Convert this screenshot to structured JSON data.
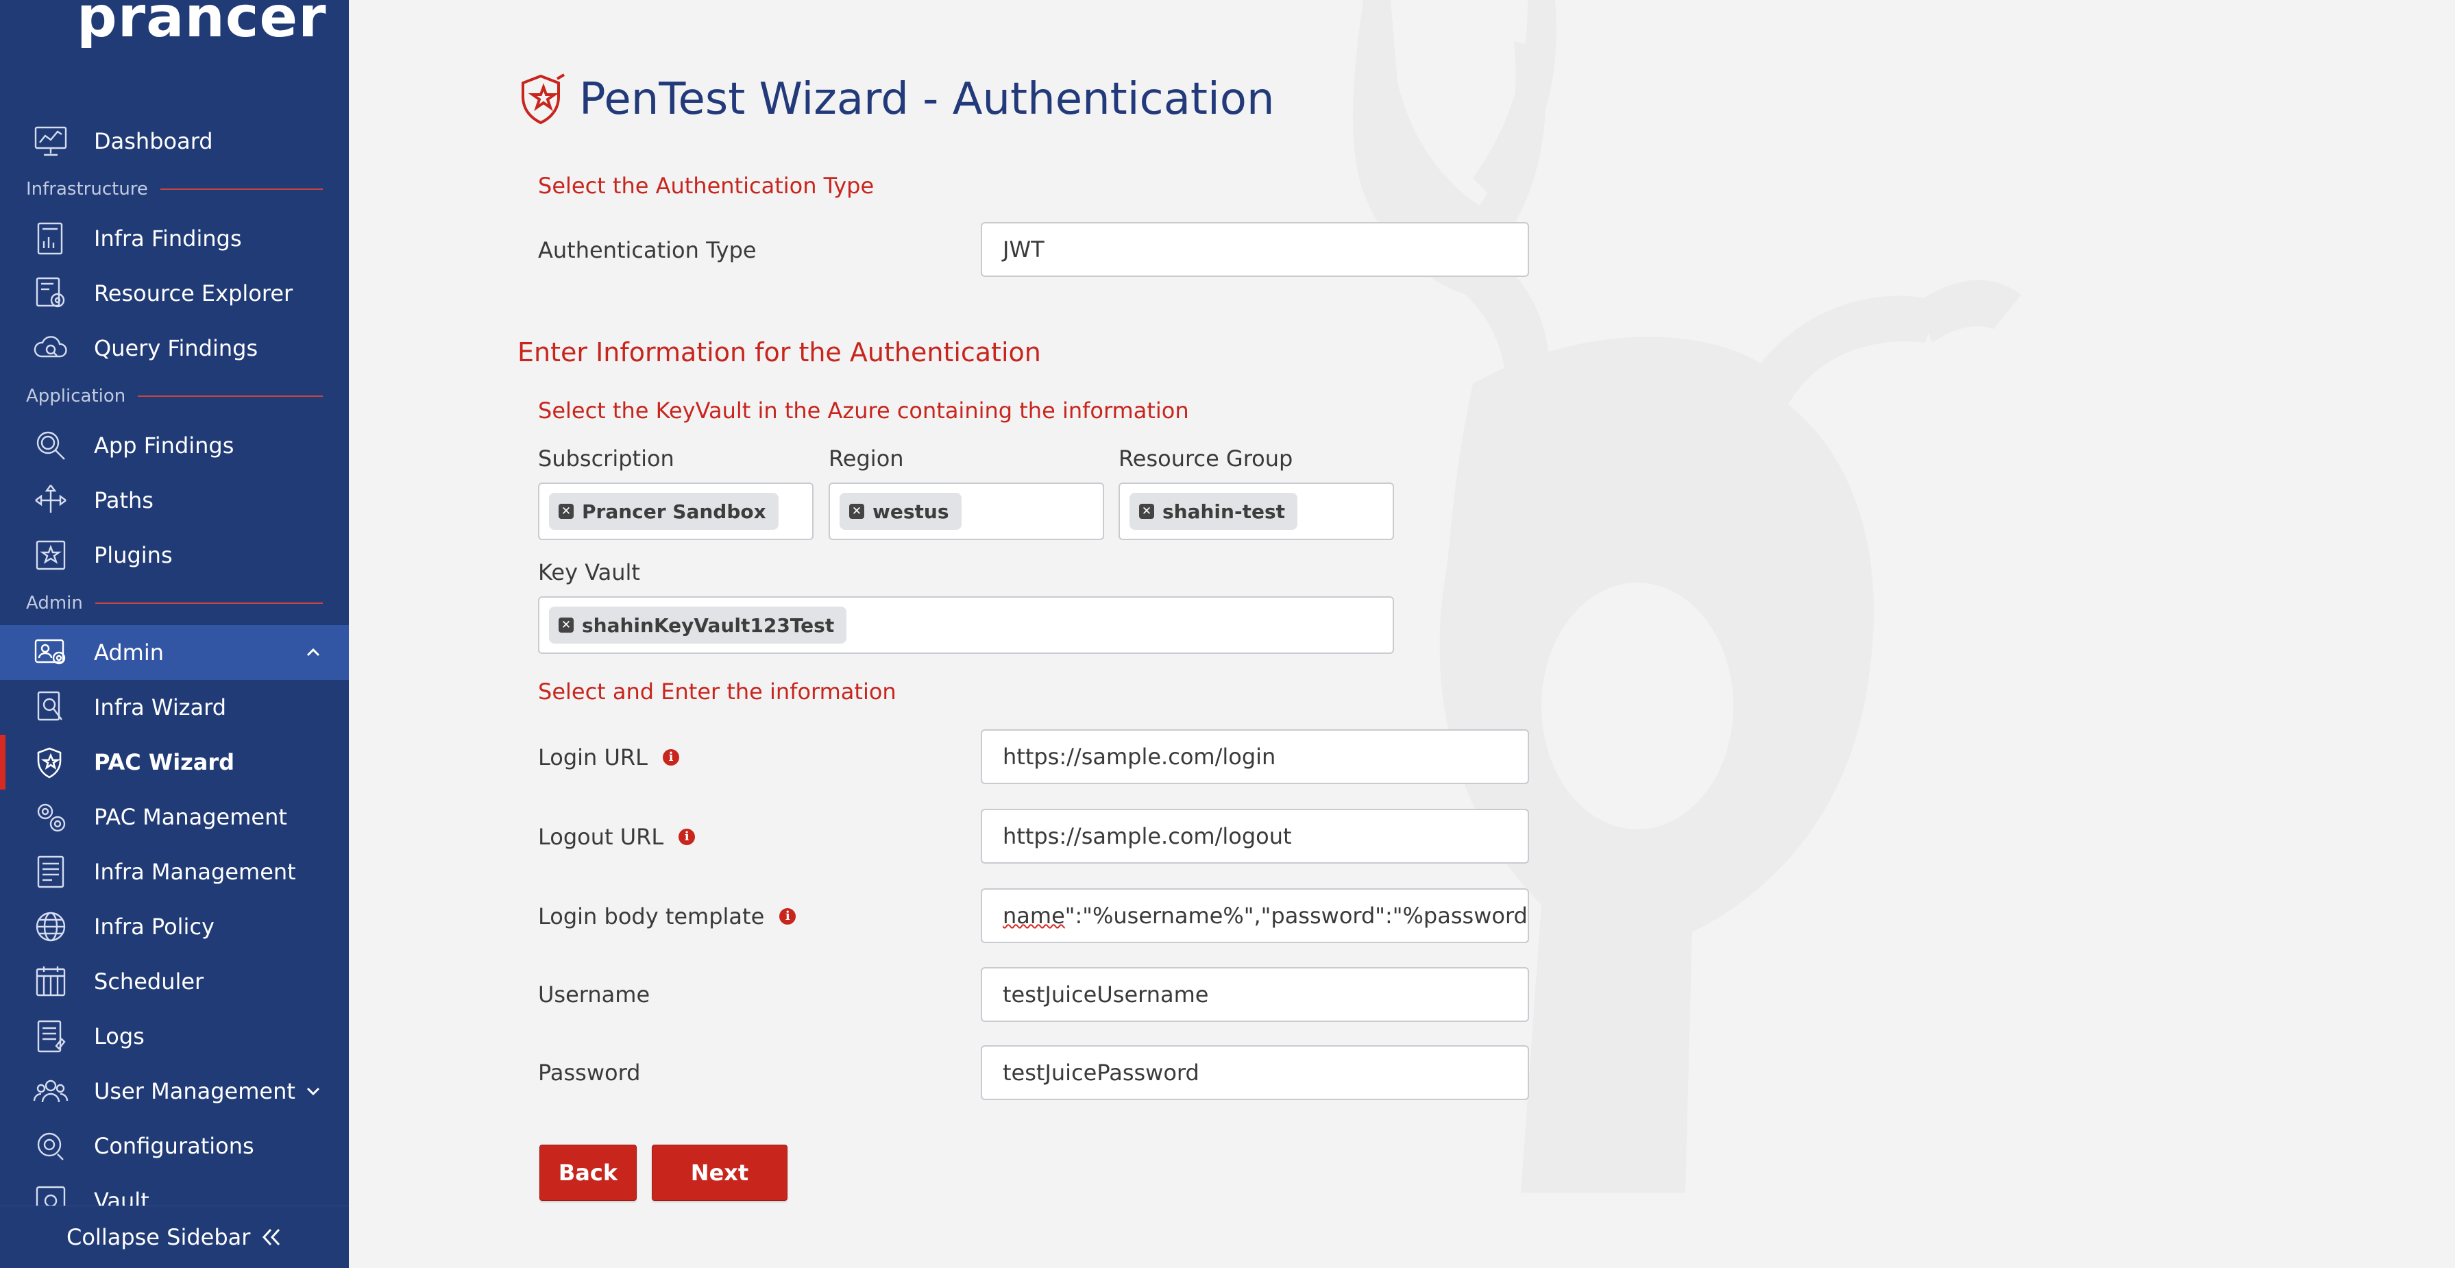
{
  "brand": {
    "logo_text": "prancer",
    "accent_color": "#c8251d",
    "sidebar_color": "#213b76"
  },
  "sidebar": {
    "dashboard": "Dashboard",
    "sections": {
      "infrastructure": "Infrastructure",
      "application": "Application",
      "admin": "Admin"
    },
    "items": {
      "infra_findings": "Infra Findings",
      "resource_explorer": "Resource Explorer",
      "query_findings": "Query Findings",
      "app_findings": "App Findings",
      "paths": "Paths",
      "plugins": "Plugins",
      "admin": "Admin",
      "infra_wizard": "Infra Wizard",
      "pac_wizard": "PAC Wizard",
      "pac_management": "PAC Management",
      "infra_management": "Infra Management",
      "infra_policy": "Infra Policy",
      "scheduler": "Scheduler",
      "logs": "Logs",
      "user_management": "User Management",
      "configurations": "Configurations",
      "vault": "Vault"
    },
    "collapse_label": "Collapse Sidebar"
  },
  "page": {
    "title": "PenTest Wizard - Authentication",
    "select_auth_heading": "Select the Authentication Type",
    "auth_type_label": "Authentication Type",
    "auth_type_value": "JWT",
    "enter_info_heading": "Enter Information for the Authentication",
    "keyvault_heading": "Select the KeyVault in the Azure containing the information",
    "subscription_label": "Subscription",
    "subscription_tag": "Prancer Sandbox",
    "region_label": "Region",
    "region_tag": "westus",
    "resource_group_label": "Resource Group",
    "resource_group_tag": "shahin-test",
    "key_vault_label": "Key Vault",
    "key_vault_tag": "shahinKeyVault123Test",
    "select_enter_heading": "Select and Enter the information",
    "login_url_label": "Login URL",
    "login_url_value": "https://sample.com/login",
    "logout_url_label": "Logout URL",
    "logout_url_value": "https://sample.com/logout",
    "login_body_label": "Login body template",
    "login_body_value_prefix": "name",
    "login_body_value_rest": "\":\"%username%\",\"password\":\"%password%\"",
    "username_label": "Username",
    "username_value": "testJuiceUsername",
    "password_label": "Password",
    "password_value": "testJuicePassword",
    "back_label": "Back",
    "next_label": "Next"
  }
}
